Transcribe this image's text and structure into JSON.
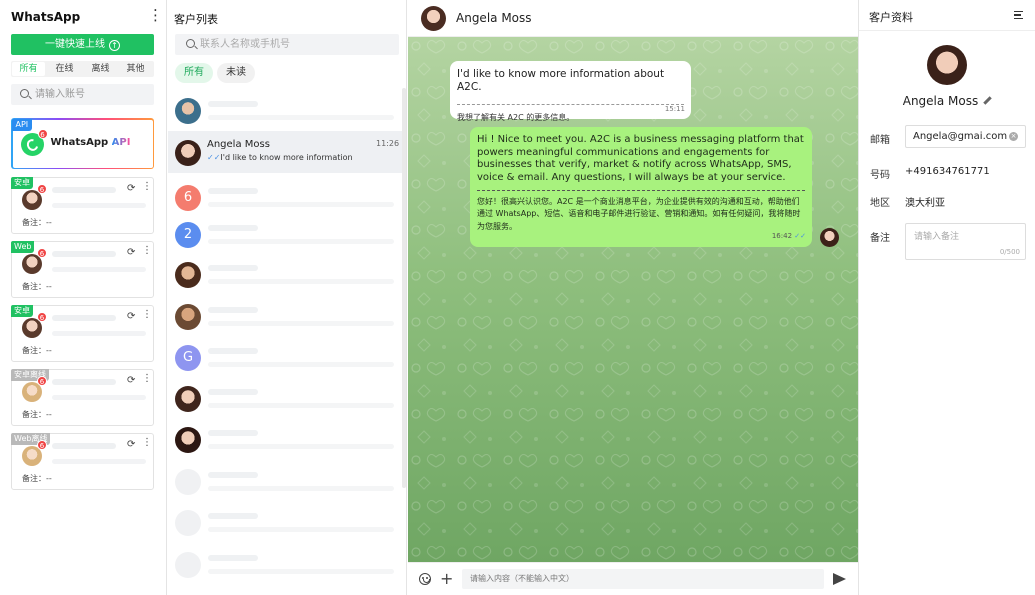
{
  "app": {
    "title": "WhatsApp"
  },
  "left": {
    "online_button": "一键快速上线",
    "tabs": [
      {
        "label": "所有",
        "active": true
      },
      {
        "label": "在线"
      },
      {
        "label": "离线"
      },
      {
        "label": "其他"
      }
    ],
    "search_placeholder": "请输入账号",
    "api_account": {
      "tag": "API",
      "label_prefix": "WhatsApp",
      "label_accent": "API",
      "badge": "6"
    },
    "accounts": [
      {
        "tag": "安卓",
        "tag_color": "#20c162",
        "badge": "6",
        "note": "备注：--"
      },
      {
        "tag": "Web",
        "tag_color": "#20c162",
        "badge": "6",
        "note": "备注：--"
      },
      {
        "tag": "安卓",
        "tag_color": "#20c162",
        "badge": "6",
        "note": "备注：--"
      },
      {
        "tag": "安卓离线",
        "tag_color": "#b9b9b9",
        "badge": "6",
        "note": "备注：--"
      },
      {
        "tag": "Web离线",
        "tag_color": "#b9b9b9",
        "badge": "6",
        "note": "备注：--"
      }
    ]
  },
  "list": {
    "title": "客户列表",
    "search_placeholder": "联系人名称或手机号",
    "chips": {
      "all": "所有",
      "unread": "未读"
    },
    "selected": {
      "name": "Angela Moss",
      "time": "11:26",
      "preview": "I'd like to know more information"
    },
    "letter_avatars": [
      {
        "letter": "6",
        "color": "#f47c6e"
      },
      {
        "letter": "2",
        "color": "#5b8def"
      },
      {
        "letter": "G",
        "color": "#8e95f0"
      }
    ]
  },
  "chat": {
    "contact_name": "Angela Moss",
    "incoming": {
      "text": "I'd like to know more information about A2C.",
      "translation": "我想了解有关 A2C 的更多信息。",
      "time": "15:11"
    },
    "outgoing": {
      "text": "Hi ! Nice to meet you. A2C is a business messaging platform that powers meaningful communications and engagements for businesses that verify, market & notify across WhatsApp, SMS, voice & email. Any questions, I will always be at your service.",
      "translation": "您好！很高兴认识您。A2C 是一个商业消息平台，为企业提供有效的沟通和互动，帮助他们通过 WhatsApp、短信、语音和电子邮件进行验证、营销和通知。如有任何疑问，我将随时为您服务。",
      "time": "16:42"
    },
    "input_placeholder": "请输入内容（不能输入中文）"
  },
  "profile": {
    "title": "客户资料",
    "name": "Angela Moss",
    "email_label": "邮箱",
    "email": "Angela@gmai.com",
    "phone_label": "号码",
    "phone": "+491634761771",
    "region_label": "地区",
    "region": "澳大利亚",
    "note_label": "备注",
    "note_placeholder": "请输入备注",
    "note_count": "0/500"
  }
}
